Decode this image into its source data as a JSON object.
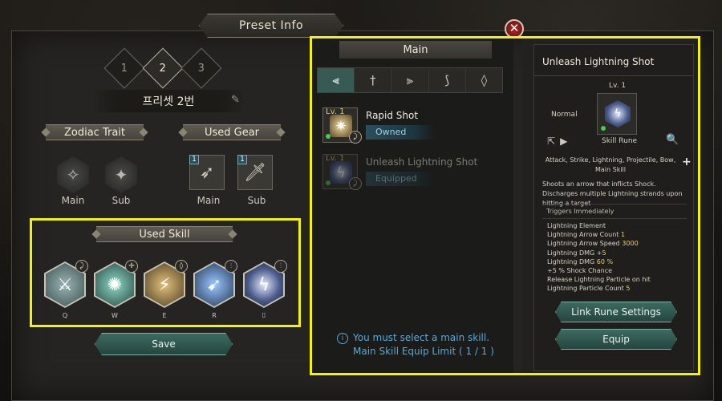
{
  "window": {
    "title": "Preset Info",
    "close_glyph": "✕"
  },
  "preset": {
    "tabs": [
      {
        "label": "1"
      },
      {
        "label": "2",
        "active": true
      },
      {
        "label": "3"
      }
    ],
    "name": "프리셋 2번"
  },
  "zodiac": {
    "title": "Zodiac Trait",
    "main_label": "Main",
    "sub_label": "Sub"
  },
  "gear": {
    "title": "Used Gear",
    "main_label": "Main",
    "sub_label": "Sub",
    "main_count": "1",
    "sub_count": "1"
  },
  "used_skill": {
    "title": "Used Skill",
    "slots": [
      {
        "key": "Q",
        "icon": "sword-icon",
        "color": "#5f7b7f"
      },
      {
        "key": "W",
        "icon": "sparkle-icon",
        "color": "#3e6a64"
      },
      {
        "key": "E",
        "icon": "bolt-icon",
        "color": "#6f5a36"
      },
      {
        "key": "R",
        "icon": "arrow-icon",
        "color": "#35557a"
      },
      {
        "key": "",
        "icon": "lightning-icon",
        "color": "#6a6fa8"
      }
    ]
  },
  "save_button": "Save",
  "main_panel": {
    "header": "Main",
    "filters": [
      "⫷",
      "†",
      "⫸",
      "⟆",
      "◊"
    ],
    "skills": [
      {
        "level": "Lv. 1",
        "name": "Rapid Shot",
        "state": "Owned",
        "color": "#7a6a4a"
      },
      {
        "level": "Lv. 1",
        "name": "Unleash Lightning Shot",
        "state": "Equipped",
        "color": "#4a5a8a"
      }
    ],
    "info_line1": "You must select a main skill.",
    "info_line2": "Main Skill Equip Limit ( 1 / 1 )"
  },
  "detail": {
    "title": "Unleash Lightning Shot",
    "level": "Lv. 1",
    "grade": "Normal",
    "rune_label": "Skill Rune",
    "tags": "Attack, Strike, Lightning, Projectile, Bow, Main Skill",
    "description": "Shoots an arrow that inflicts Shock. Discharges multiple Lightning strands upon hitting a target",
    "trigger": "Triggers Immediately",
    "stats": [
      {
        "label": "Lightning Element",
        "value": ""
      },
      {
        "label": "Lightning Arrow Count",
        "value": "1"
      },
      {
        "label": "Lightning Arrow Speed",
        "value": "3000"
      },
      {
        "label": "Lightning DMG +",
        "value": "5"
      },
      {
        "label": "Lightning DMG",
        "value": "60 %"
      },
      {
        "label": "+5 % Shock Chance",
        "value": ""
      },
      {
        "label": "Release Lightning Particle on hit",
        "value": ""
      },
      {
        "label": "Lightning Particle Count",
        "value": "5"
      }
    ],
    "link_button": "Link Rune Settings",
    "equip_button": "Equip"
  }
}
